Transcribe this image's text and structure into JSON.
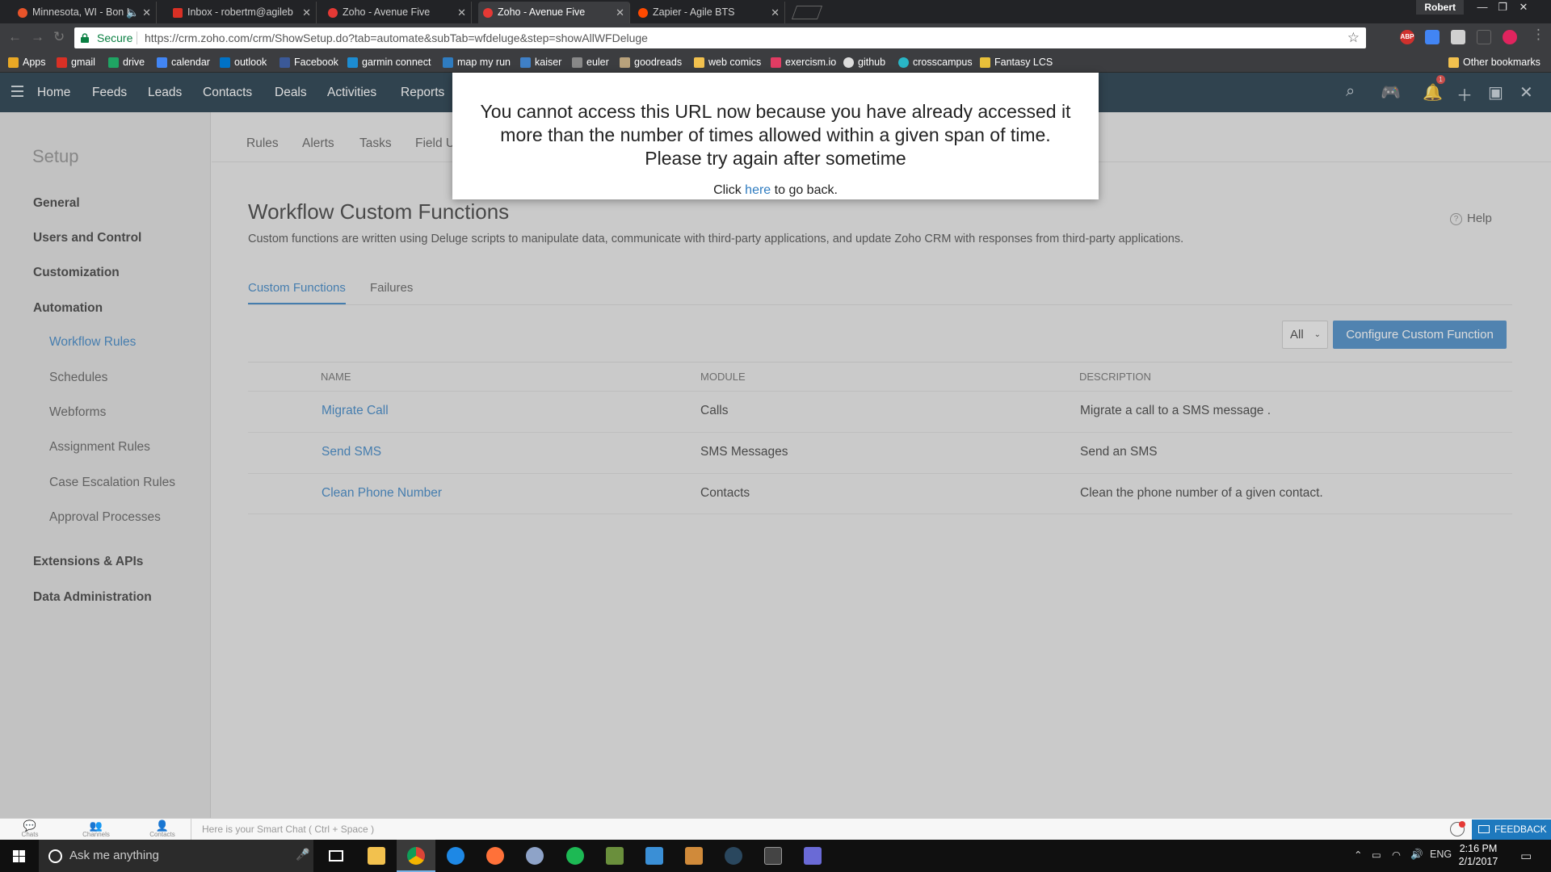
{
  "browser": {
    "tabs": [
      {
        "title": "Minnesota, WI - Bon I",
        "favicon_color": "#e8542a",
        "active": false
      },
      {
        "title": "Inbox - robertm@agileb",
        "favicon_color": "#d93025",
        "active": false
      },
      {
        "title": "Zoho - Avenue Five",
        "favicon_color": "#e53935",
        "active": false
      },
      {
        "title": "Zoho - Avenue Five",
        "favicon_color": "#e53935",
        "active": true
      },
      {
        "title": "Zapier - Agile BTS",
        "favicon_color": "#ff4a00",
        "active": false
      }
    ],
    "profile_name": "Robert",
    "secure_label": "Secure",
    "url": "https://crm.zoho.com/crm/ShowSetup.do?tab=automate&subTab=wfdeluge&step=showAllWFDeluge",
    "extensions": [
      {
        "icon": "adblock-icon",
        "label": "ABP",
        "color": "#d0312d"
      },
      {
        "icon": "calendar-ext-icon",
        "label": "",
        "color": "#4285f4"
      },
      {
        "icon": "ext-icon",
        "label": "",
        "color": "#d0d0d0"
      },
      {
        "icon": "cast-icon",
        "label": "",
        "color": "#666666"
      },
      {
        "icon": "ext-red-icon",
        "label": "",
        "color": "#e0245e"
      }
    ],
    "bookmarks": [
      {
        "label": "Apps",
        "icon": "apps-grid-icon",
        "color": "#e9a825"
      },
      {
        "label": "gmail",
        "icon": "gmail-icon",
        "color": "#d93025"
      },
      {
        "label": "drive",
        "icon": "drive-icon",
        "color": "#1fa463"
      },
      {
        "label": "calendar",
        "icon": "calendar-icon",
        "color": "#4285f4"
      },
      {
        "label": "outlook",
        "icon": "outlook-icon",
        "color": "#0072c6"
      },
      {
        "label": "Facebook",
        "icon": "facebook-icon",
        "color": "#3b5998"
      },
      {
        "label": "garmin connect",
        "icon": "garmin-icon",
        "color": "#1d8cd1"
      },
      {
        "label": "map my run",
        "icon": "mapmyrun-icon",
        "color": "#2f7cc0"
      },
      {
        "label": "kaiser",
        "icon": "kaiser-icon",
        "color": "#3f80c7"
      },
      {
        "label": "euler",
        "icon": "euler-icon",
        "color": "#888888"
      },
      {
        "label": "goodreads",
        "icon": "goodreads-icon",
        "color": "#b9a27c"
      },
      {
        "label": "web comics",
        "icon": "folder-icon",
        "color": "#f2c14e"
      },
      {
        "label": "exercism.io",
        "icon": "exercism-icon",
        "color": "#e13c63"
      },
      {
        "label": "github",
        "icon": "github-icon",
        "color": "#dddddd"
      },
      {
        "label": "crosscampus",
        "icon": "crosscampus-icon",
        "color": "#29b6c6"
      },
      {
        "label": "Fantasy LCS",
        "icon": "lcs-icon",
        "color": "#e8c03a"
      }
    ],
    "other_bookmarks": "Other bookmarks"
  },
  "zoho_nav": {
    "items": [
      "Home",
      "Feeds",
      "Leads",
      "Contacts",
      "Deals",
      "Activities",
      "Reports"
    ],
    "notification_count": "1"
  },
  "sidebar": {
    "title": "Setup",
    "groups": [
      "General",
      "Users and Control",
      "Customization",
      "Automation",
      "Extensions & APIs",
      "Data Administration"
    ],
    "automation_items": [
      "Workflow Rules",
      "Schedules",
      "Webforms",
      "Assignment Rules",
      "Case Escalation Rules",
      "Approval Processes"
    ],
    "active_item": "Workflow Rules"
  },
  "subtabs": [
    "Rules",
    "Alerts",
    "Tasks",
    "Field U"
  ],
  "main": {
    "title": "Workflow Custom Functions",
    "description": "Custom functions are written using Deluge scripts to manipulate data, communicate with third-party applications, and update Zoho CRM with responses from third-party applications.",
    "help": "Help",
    "content_tabs": [
      "Custom Functions",
      "Failures"
    ],
    "filter_value": "All",
    "configure_button": "Configure Custom Function",
    "columns": [
      "NAME",
      "MODULE",
      "DESCRIPTION"
    ],
    "rows": [
      {
        "name": "Migrate Call",
        "module": "Calls",
        "description": "Migrate a call to a SMS message ."
      },
      {
        "name": "Send SMS",
        "module": "SMS Messages",
        "description": "Send an SMS"
      },
      {
        "name": "Clean Phone Number",
        "module": "Contacts",
        "description": "Clean the phone number of a given contact."
      }
    ]
  },
  "modal": {
    "message_line1": "You cannot access this URL now because you have already accessed it",
    "message_line2": "more than the number of times allowed within a given span of time.",
    "message_line3": "Please try again after sometime",
    "back_prefix": "Click ",
    "back_link": "here",
    "back_suffix": " to go back."
  },
  "bottom_bar": {
    "icons": [
      "Chats",
      "Channels",
      "Contacts"
    ],
    "smartchat_placeholder": "Here is your Smart Chat ( Ctrl + Space )",
    "feedback": "FEEDBACK"
  },
  "taskbar": {
    "search_placeholder": "Ask me anything",
    "apps": [
      {
        "name": "task-view",
        "color": "#ffffff"
      },
      {
        "name": "file-explorer",
        "color": "#f2c14e"
      },
      {
        "name": "chrome",
        "color": "#4caf50"
      },
      {
        "name": "edge",
        "color": "#1e88e5"
      },
      {
        "name": "firefox",
        "color": "#ff7139"
      },
      {
        "name": "vpn",
        "color": "#8ea3c8"
      },
      {
        "name": "spotify",
        "color": "#1db954"
      },
      {
        "name": "minecraft",
        "color": "#6a8f3c"
      },
      {
        "name": "sublime-like",
        "color": "#3a8fd6"
      },
      {
        "name": "app-orange",
        "color": "#d08a3a"
      },
      {
        "name": "steam",
        "color": "#2a475e"
      },
      {
        "name": "terminal",
        "color": "#444444"
      },
      {
        "name": "network-app",
        "color": "#6a6ad6"
      }
    ],
    "language": "ENG",
    "time": "2:16 PM",
    "date": "2/1/2017"
  }
}
